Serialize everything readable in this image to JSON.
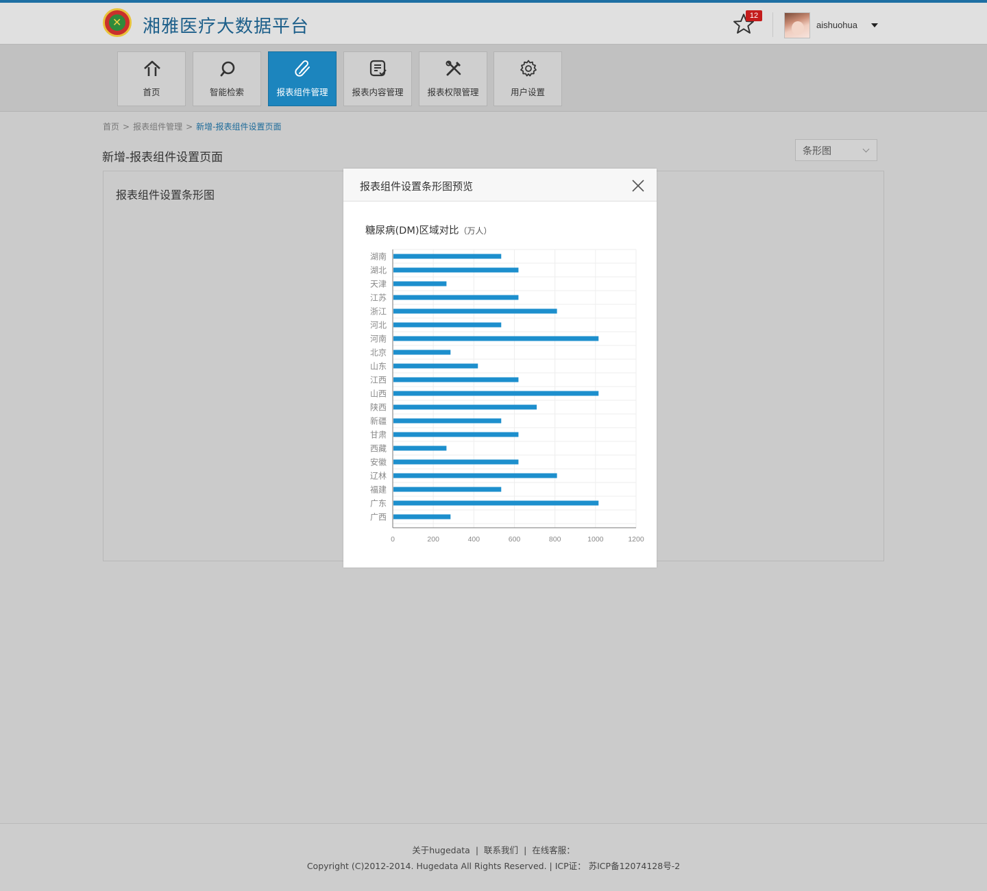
{
  "header": {
    "app_title": "湘雅医疗大数据平台",
    "notification_count": "12",
    "username": "aishuohua"
  },
  "nav": {
    "items": [
      {
        "label": "首页",
        "icon": "home-icon"
      },
      {
        "label": "智能检索",
        "icon": "search-icon"
      },
      {
        "label": "报表组件管理",
        "icon": "paperclip-icon",
        "active": true
      },
      {
        "label": "报表内容管理",
        "icon": "report-check-icon"
      },
      {
        "label": "报表权限管理",
        "icon": "tools-icon"
      },
      {
        "label": "用户设置",
        "icon": "gear-icon"
      }
    ]
  },
  "breadcrumb": {
    "items": [
      "首页",
      "报表组件管理",
      "新增-报表组件设置页面"
    ],
    "separator": ">"
  },
  "page": {
    "title": "新增-报表组件设置页面",
    "chart_type_select": "条形图",
    "panel_title": "报表组件设置条形图"
  },
  "modal": {
    "title": "报表组件设置条形图预览"
  },
  "chart_data": {
    "type": "bar",
    "orientation": "horizontal",
    "title": "糖尿病(DM)区域对比",
    "unit": "（万人）",
    "xlabel": "",
    "ylabel": "",
    "categories": [
      "湖南",
      "湖北",
      "天津",
      "江苏",
      "浙江",
      "河北",
      "河南",
      "北京",
      "山东",
      "江西",
      "山西",
      "陕西",
      "新疆",
      "甘肃",
      "西藏",
      "安徽",
      "辽林",
      "福建",
      "广东",
      "广西"
    ],
    "values": [
      535,
      620,
      265,
      620,
      810,
      535,
      1015,
      285,
      420,
      620,
      1015,
      710,
      535,
      620,
      265,
      620,
      810,
      535,
      1015,
      285
    ],
    "xlim": [
      0,
      1200
    ],
    "xticks": [
      "0",
      "200",
      "400",
      "600",
      "800",
      "1000",
      "1200"
    ],
    "grid": true,
    "bar_color": "#1d8fcd"
  },
  "footer": {
    "links": [
      "关于hugedata",
      "联系我们",
      "在线客服："
    ],
    "copyright": "Copyright (C)2012-2014. Hugedata All Rights Reserved. | ICP证： 苏ICP备12074128号-2"
  },
  "colors": {
    "brand": "#1d5f8a",
    "accent": "#1c85be",
    "badge": "#c41c1c"
  }
}
